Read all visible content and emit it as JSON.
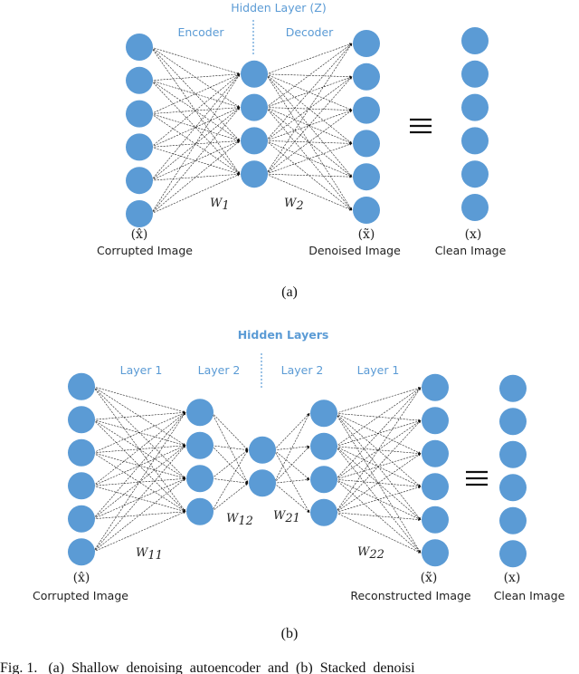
{
  "panel_a": {
    "title": "Hidden Layer (Z)",
    "encoder_label": "Encoder",
    "decoder_label": "Decoder",
    "layers": [
      {
        "name": "input",
        "nodes": 6
      },
      {
        "name": "hidden",
        "nodes": 4
      },
      {
        "name": "output",
        "nodes": 6
      }
    ],
    "clean_nodes": 6,
    "weights": {
      "w1": "W",
      "w1_sub": "1",
      "w2": "W",
      "w2_sub": "2"
    },
    "input_symbol": "(x̂)",
    "input_label": "Corrupted Image",
    "output_symbol": "(x̃)",
    "output_label": "Denoised Image",
    "clean_symbol": "(x)",
    "clean_label": "Clean Image",
    "equiv_symbol": "≡",
    "caption": "(a)"
  },
  "panel_b": {
    "title": "Hidden Layers",
    "layer_labels": [
      "Layer 1",
      "Layer 2",
      "Layer 2",
      "Layer 1"
    ],
    "layers": [
      {
        "name": "input",
        "nodes": 6
      },
      {
        "name": "enc-layer-1",
        "nodes": 4
      },
      {
        "name": "bottleneck",
        "nodes": 2
      },
      {
        "name": "dec-layer-2",
        "nodes": 4
      },
      {
        "name": "output",
        "nodes": 6
      }
    ],
    "clean_nodes": 6,
    "weights": [
      {
        "base": "W",
        "sub": "11"
      },
      {
        "base": "W",
        "sub": "12"
      },
      {
        "base": "W",
        "sub": "21"
      },
      {
        "base": "W",
        "sub": "22"
      }
    ],
    "input_symbol": "(x̂)",
    "input_label": "Corrupted Image",
    "output_symbol": "(x̃)",
    "output_label": "Reconstructed Image",
    "clean_symbol": "(x)",
    "clean_label": "Clean Image",
    "equiv_symbol": "≡",
    "caption": "(b)"
  },
  "figure_caption": "Fig. 1.   (a)  Shallow  denoising  autoencoder  and  (b)  Stacked  denoisi",
  "colors": {
    "node": "#5b9bd5",
    "label_blue": "#5b9bd5",
    "edge": "#222222"
  }
}
